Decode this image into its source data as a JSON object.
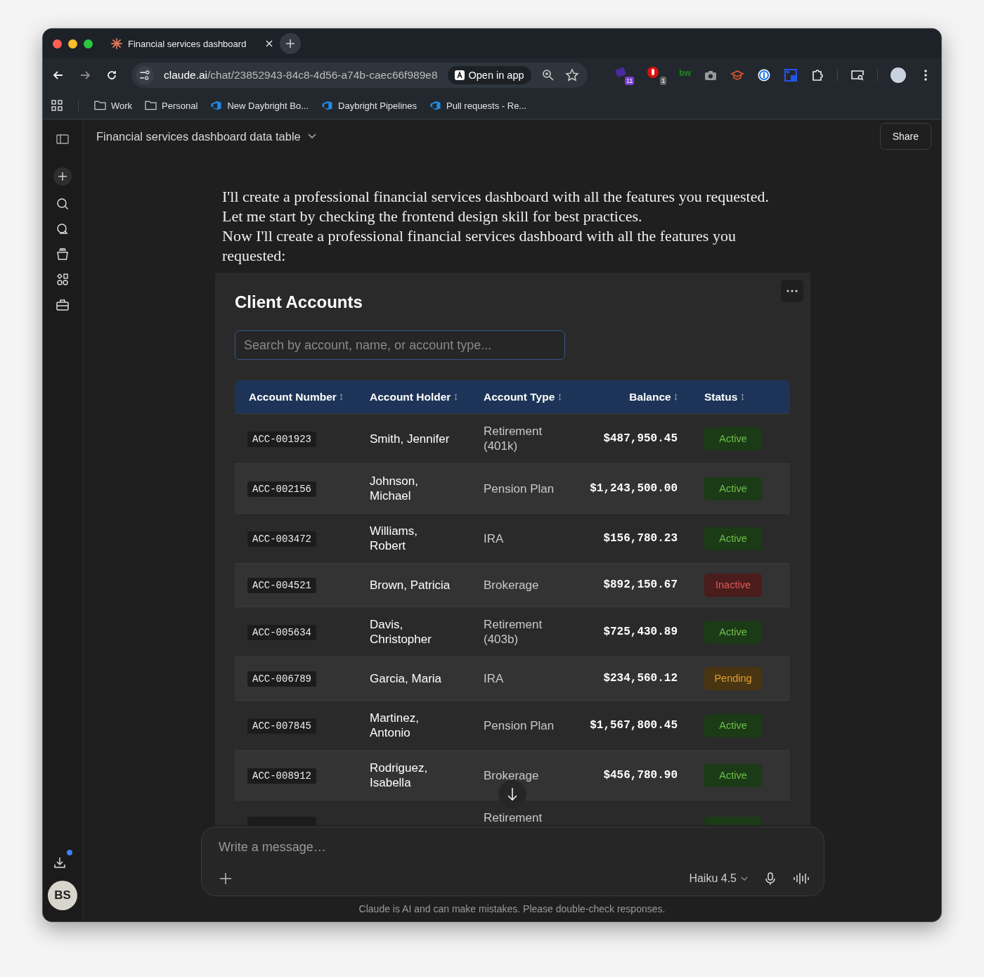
{
  "browser": {
    "tab_title": "Financial services dashboard",
    "url_host": "claude.ai",
    "url_path": "/chat/23852943-84c8-4d56-a74b-caec66f989e8",
    "open_in_app": "Open in app",
    "extensions": [
      {
        "kind": "stack",
        "badge": "11"
      },
      {
        "kind": "hand",
        "badge": "1"
      },
      {
        "kind": "text",
        "label": "bw"
      },
      {
        "kind": "camera"
      },
      {
        "kind": "cap"
      },
      {
        "kind": "key"
      },
      {
        "kind": "squares"
      },
      {
        "kind": "puzzle"
      }
    ],
    "bookmarks": [
      {
        "kind": "folder",
        "label": "Work"
      },
      {
        "kind": "folder",
        "label": "Personal"
      },
      {
        "kind": "devops",
        "label": "New Daybright Bo..."
      },
      {
        "kind": "devops",
        "label": "Daybright Pipelines"
      },
      {
        "kind": "devops",
        "label": "Pull requests - Re..."
      }
    ]
  },
  "sidebar": {
    "avatar_initials": "BS",
    "download_badge": true
  },
  "header": {
    "title": "Financial services dashboard data table",
    "share": "Share"
  },
  "message": {
    "paragraphs": [
      "I'll create a professional financial services dashboard with all the features you requested. Let me start by checking the frontend design skill for best practices.",
      "Now I'll create a professional financial services dashboard with all the features you requested:"
    ]
  },
  "artifact": {
    "title": "Client Accounts",
    "search": {
      "placeholder": "Search by account, name, or account type..."
    },
    "table": {
      "columns": [
        "Account Number",
        "Account Holder",
        "Account Type",
        "Balance",
        "Status"
      ],
      "rows": [
        {
          "account": "ACC-001923",
          "holder": "Smith, Jennifer",
          "type": "Retirement (401k)",
          "balance": "$487,950.45",
          "status": "Active",
          "kind": "active"
        },
        {
          "account": "ACC-002156",
          "holder": "Johnson, Michael",
          "type": "Pension Plan",
          "balance": "$1,243,500.00",
          "status": "Active",
          "kind": "active"
        },
        {
          "account": "ACC-003472",
          "holder": "Williams, Robert",
          "type": "IRA",
          "balance": "$156,780.23",
          "status": "Active",
          "kind": "active"
        },
        {
          "account": "ACC-004521",
          "holder": "Brown, Patricia",
          "type": "Brokerage",
          "balance": "$892,150.67",
          "status": "Inactive",
          "kind": "inactive"
        },
        {
          "account": "ACC-005634",
          "holder": "Davis, Christopher",
          "type": "Retirement (403b)",
          "balance": "$725,430.89",
          "status": "Active",
          "kind": "active"
        },
        {
          "account": "ACC-006789",
          "holder": "Garcia, Maria",
          "type": "IRA",
          "balance": "$234,560.12",
          "status": "Pending",
          "kind": "pending"
        },
        {
          "account": "ACC-007845",
          "holder": "Martinez, Antonio",
          "type": "Pension Plan",
          "balance": "$1,567,800.45",
          "status": "Active",
          "kind": "active"
        },
        {
          "account": "ACC-008912",
          "holder": "Rodriguez, Isabella",
          "type": "Brokerage",
          "balance": "$456,780.90",
          "status": "Active",
          "kind": "active"
        }
      ],
      "partial_row": {
        "type": "Retirement",
        "kind": "active"
      }
    }
  },
  "composer": {
    "placeholder": "Write a message…",
    "model": "Haiku 4.5"
  },
  "disclaimer": "Claude is AI and can make mistakes. Please double-check responses."
}
